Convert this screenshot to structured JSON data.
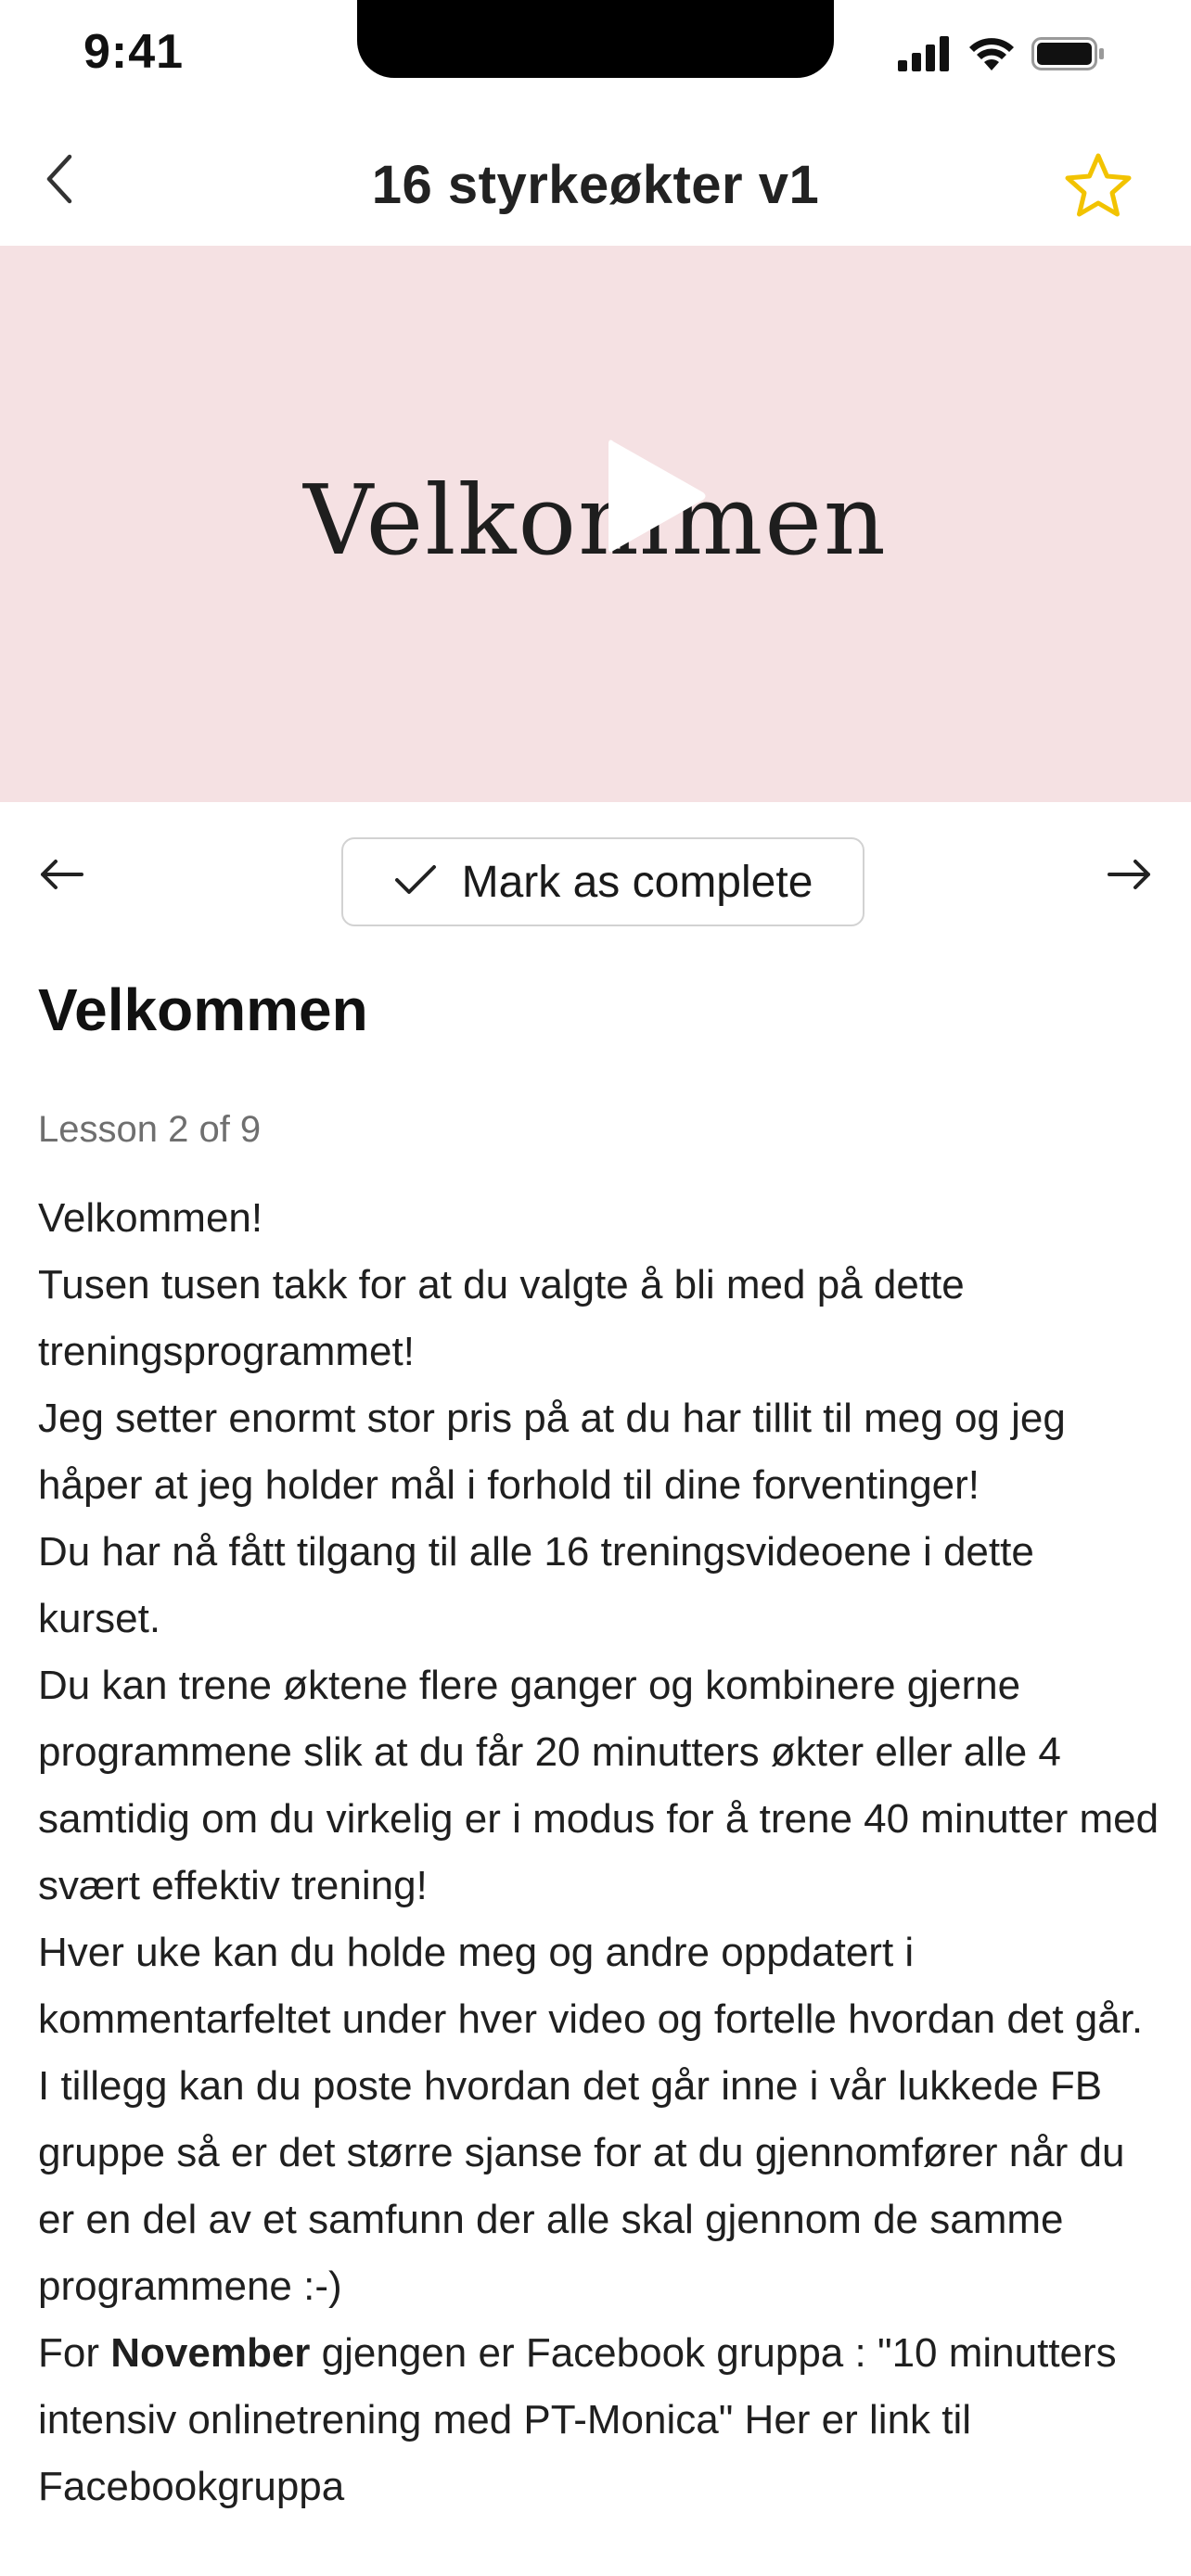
{
  "status_bar": {
    "time": "9:41",
    "icons": [
      "cellular-signal-icon",
      "wifi-icon",
      "battery-icon"
    ]
  },
  "header": {
    "title": "16 styrkeøkter v1",
    "back_icon": "chevron-left-icon",
    "favorite_icon": "star-outline-icon",
    "accent_color": "#f2c300"
  },
  "video": {
    "caption": "Velkommen",
    "background_color": "#f5e1e3",
    "play_icon": "play-icon"
  },
  "lesson_nav": {
    "prev_icon": "arrow-left-icon",
    "next_icon": "arrow-right-icon",
    "complete_button": {
      "icon": "checkmark-icon",
      "label": "Mark as complete"
    }
  },
  "lesson": {
    "title": "Velkommen",
    "progress_text": "Lesson 2 of 9",
    "paragraphs": [
      "Velkommen!",
      "Tusen tusen takk for at du valgte å bli med på dette treningsprogrammet!",
      "Jeg setter enormt stor pris på at du har tillit til meg og jeg håper at jeg holder mål i forhold til dine forventinger!",
      "Du har nå fått tilgang til alle 16 treningsvideoene i dette kurset.",
      "Du kan trene øktene flere ganger og kombinere gjerne programmene slik at du får 20 minutters økter eller alle 4 samtidig om du virkelig er i modus for å trene 40 minutter med svært effektiv trening!",
      "Hver uke kan du holde meg og andre oppdatert i kommentarfeltet under hver video og fortelle hvordan det går.",
      "I tillegg kan du poste hvordan det går inne i vår lukkede FB gruppe så er det større sjanse for at du gjennomfører når du er en del av et samfunn der alle skal gjennom de samme programmene :-)"
    ],
    "last_paragraph": {
      "prefix": "For ",
      "bold": "November",
      "suffix": " gjengen er Facebook gruppa : \"10 minutters intensiv onlinetrening med PT-Monica\" Her er link til Facebookgruppa"
    }
  }
}
